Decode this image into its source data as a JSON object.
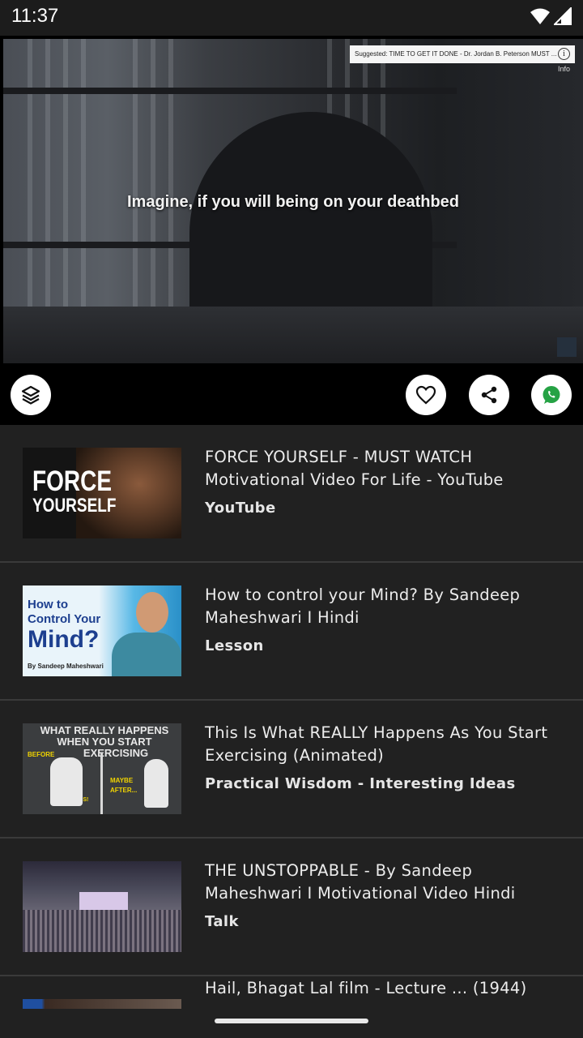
{
  "status_bar": {
    "time": "11:37"
  },
  "player": {
    "subtitle": "Imagine, if you will being on your deathbed",
    "suggested": "Suggested: TIME TO GET IT DONE - Dr. Jordan B. Peterson MUST ...",
    "info_label": "Info",
    "info_icon_char": "i"
  },
  "actions": {
    "layers_icon": "layers-icon",
    "heart_icon": "heart-icon",
    "share_icon": "share-icon",
    "whatsapp_icon": "whatsapp-icon",
    "whatsapp_color": "#25a244"
  },
  "videos": [
    {
      "title": "FORCE YOURSELF - MUST WATCH Motivational Video For Life - YouTube",
      "source": "YouTube",
      "thumb_text": [
        "FORCE",
        "YOURSELF"
      ]
    },
    {
      "title": "How to control your Mind? By Sandeep Maheshwari I Hindi",
      "source": "Lesson",
      "thumb_text": [
        "How to",
        "Control Your",
        "Mind?",
        "By Sandeep Maheshwari"
      ]
    },
    {
      "title": "This Is What REALLY Happens As You Start Exercising (Animated)",
      "source": "Practical Wisdom - Interesting Ideas",
      "thumb_text": [
        "WHAT REALLY HAPPENS",
        "WHEN YOU START",
        "EXERCISING",
        "BEFORE",
        "MAYBE",
        "AFTER...",
        "YIKES!"
      ]
    },
    {
      "title": "THE UNSTOPPABLE - By Sandeep Maheshwari I Motivational Video Hindi",
      "source": "Talk",
      "thumb_text": []
    },
    {
      "title": "Hail, Bhagat Lal film - Lecture ... (1944)",
      "source": "",
      "thumb_text": []
    }
  ],
  "colors": {
    "background": "#212121",
    "divider": "#3a3a3a",
    "status_bar": "#1c1c1c"
  }
}
